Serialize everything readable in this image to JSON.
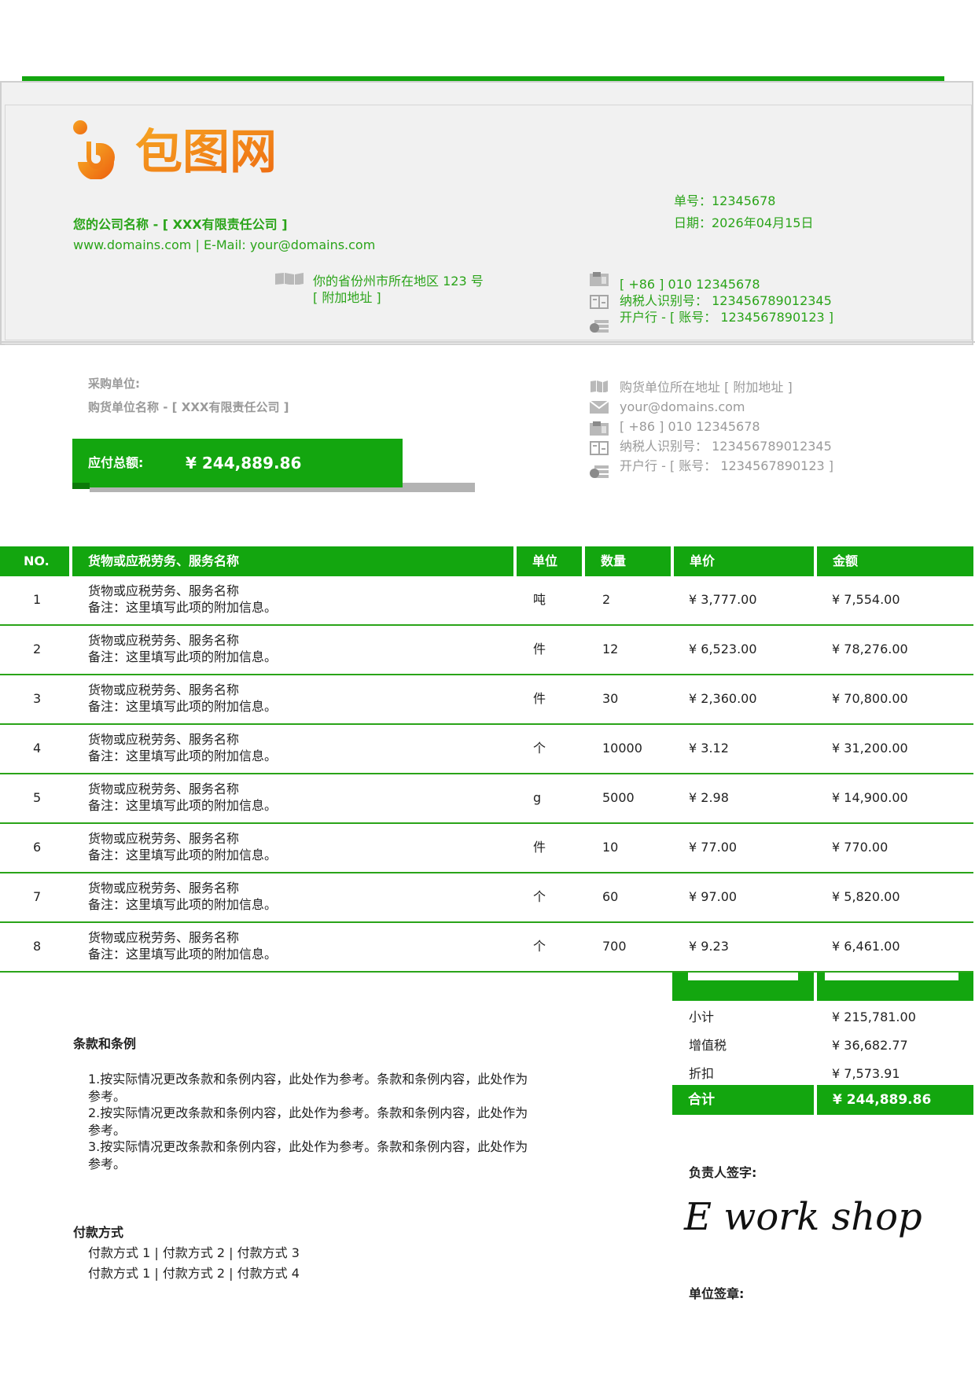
{
  "brand": {
    "logo_text": "包图网",
    "logo_color": "#f07d1a",
    "accent_color": "#13a60f"
  },
  "company": {
    "name": "您的公司名称 - [ XXX有限责任公司 ]",
    "web_email": "www.domains.com | E-Mail:  your@domains.com",
    "address_line1": "你的省份州市所在地区  123 号",
    "address_line2": "[  附加地址  ]",
    "phone": "[ +86 ] 010 12345678",
    "tax_id": "纳税人识别号：  123456789012345",
    "bank": "开户行 - [  账号：  1234567890123 ]"
  },
  "invoice": {
    "number": "单号：12345678",
    "date": "日期：2026年04月15日"
  },
  "buyer": {
    "label": "采购单位:",
    "name": "购货单位名称 - [ XXX有限责任公司 ]",
    "address": "购货单位所在地址 [  附加地址  ]",
    "email": "your@domains.com",
    "phone": "[ +86 ] 010 12345678",
    "tax_id": "纳税人识别号：  123456789012345",
    "bank": "开户行 - [  账号：  1234567890123 ]"
  },
  "amount_due": {
    "label": "应付总额:",
    "value": "¥ 244,889.86"
  },
  "table": {
    "headers": [
      "NO.",
      "货物或应税劳务、服务名称",
      "单位",
      "数量",
      "单价",
      "金额"
    ],
    "rows": [
      {
        "no": "1",
        "name": "货物或应税劳务、服务名称",
        "note": "备注：这里填写此项的附加信息。",
        "unit": "吨",
        "qty": "2",
        "price": "¥ 3,777.00",
        "amount": "¥ 7,554.00"
      },
      {
        "no": "2",
        "name": "货物或应税劳务、服务名称",
        "note": "备注：这里填写此项的附加信息。",
        "unit": "件",
        "qty": "12",
        "price": "¥ 6,523.00",
        "amount": "¥ 78,276.00"
      },
      {
        "no": "3",
        "name": "货物或应税劳务、服务名称",
        "note": "备注：这里填写此项的附加信息。",
        "unit": "件",
        "qty": "30",
        "price": "¥ 2,360.00",
        "amount": "¥ 70,800.00"
      },
      {
        "no": "4",
        "name": "货物或应税劳务、服务名称",
        "note": "备注：这里填写此项的附加信息。",
        "unit": "个",
        "qty": "10000",
        "price": "¥ 3.12",
        "amount": "¥ 31,200.00"
      },
      {
        "no": "5",
        "name": "货物或应税劳务、服务名称",
        "note": "备注：这里填写此项的附加信息。",
        "unit": "g",
        "qty": "5000",
        "price": "¥ 2.98",
        "amount": "¥ 14,900.00"
      },
      {
        "no": "6",
        "name": "货物或应税劳务、服务名称",
        "note": "备注：这里填写此项的附加信息。",
        "unit": "件",
        "qty": "10",
        "price": "¥ 77.00",
        "amount": "¥ 770.00"
      },
      {
        "no": "7",
        "name": "货物或应税劳务、服务名称",
        "note": "备注：这里填写此项的附加信息。",
        "unit": "个",
        "qty": "60",
        "price": "¥ 97.00",
        "amount": "¥ 5,820.00"
      },
      {
        "no": "8",
        "name": "货物或应税劳务、服务名称",
        "note": "备注：这里填写此项的附加信息。",
        "unit": "个",
        "qty": "700",
        "price": "¥ 9.23",
        "amount": "¥ 6,461.00"
      }
    ]
  },
  "totals": {
    "subtotal_label": "小计",
    "subtotal": "¥ 215,781.00",
    "vat_label": "增值税",
    "vat": "¥ 36,682.77",
    "discount_label": "折扣",
    "discount": "¥ 7,573.91",
    "total_label": "合计",
    "total": "¥ 244,889.86"
  },
  "terms": {
    "title": "条款和条例",
    "items": [
      "1.按实际情况更改条款和条例内容，此处作为参考。条款和条例内容，此处作为参考。",
      "2.按实际情况更改条款和条例内容，此处作为参考。条款和条例内容，此处作为参考。",
      "3.按实际情况更改条款和条例内容，此处作为参考。条款和条例内容，此处作为参考。"
    ]
  },
  "payment": {
    "title": "付款方式",
    "line1": "付款方式 1 | 付款方式 2 | 付款方式 3",
    "line2": "付款方式 1 | 付款方式 2 | 付款方式 4"
  },
  "signature": {
    "label": "负责人签字:",
    "text": "E work shop",
    "stamp_label": "单位签章:"
  }
}
